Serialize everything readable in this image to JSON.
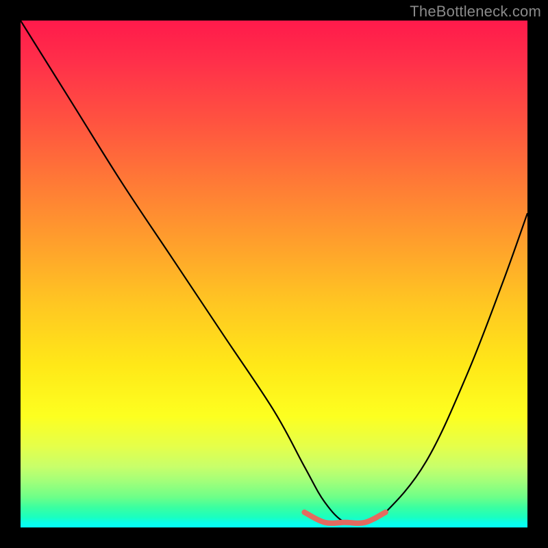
{
  "watermark": {
    "text": "TheBottleneck.com"
  },
  "chart_data": {
    "type": "line",
    "title": "",
    "xlabel": "",
    "ylabel": "",
    "xlim": [
      0,
      100
    ],
    "ylim": [
      0,
      100
    ],
    "grid": false,
    "legend": false,
    "background": {
      "orientation": "vertical",
      "top_color": "#ff1a4b",
      "bottom_color": "#06fff6",
      "meaning": "red = high bottleneck, green = low bottleneck"
    },
    "series": [
      {
        "name": "bottleneck-curve",
        "color": "#000000",
        "x": [
          0,
          10,
          20,
          30,
          40,
          50,
          56,
          60,
          64,
          68,
          72,
          80,
          88,
          95,
          100
        ],
        "values": [
          100,
          84,
          68,
          53,
          38,
          23,
          12,
          5,
          1,
          1,
          3,
          13,
          30,
          48,
          62
        ]
      },
      {
        "name": "optimal-range-marker",
        "color": "#e46a5f",
        "x": [
          56,
          60,
          64,
          68,
          72
        ],
        "values": [
          3,
          1,
          1,
          1,
          3
        ]
      }
    ],
    "optimal_range": {
      "x_start": 56,
      "x_end": 72,
      "min_value": 1
    }
  }
}
